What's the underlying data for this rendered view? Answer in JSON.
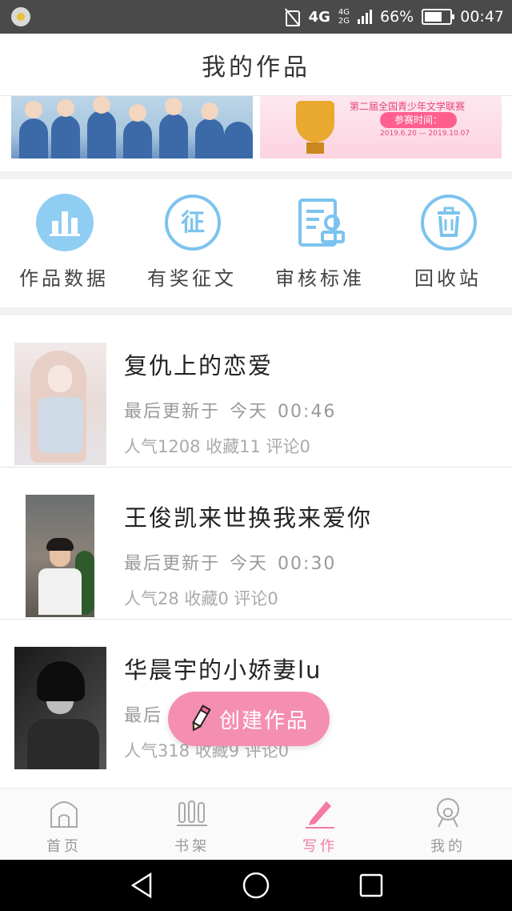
{
  "status_bar": {
    "network": "4G",
    "signal_labels": [
      "4G",
      "2G"
    ],
    "battery": "66%",
    "time": "00:47"
  },
  "header": {
    "title": "我的作品"
  },
  "banners": [
    {
      "name": "cast-photo-banner"
    },
    {
      "title": "第二届全国青少年文学联赛",
      "pill": "参赛时间：",
      "date": "2019.6.20 — 2019.10.07"
    }
  ],
  "menu": [
    {
      "label": "作品数据",
      "icon": "chart-bars-icon"
    },
    {
      "label": "有奖征文",
      "icon": "contest-icon"
    },
    {
      "label": "审核标准",
      "icon": "review-standard-icon"
    },
    {
      "label": "回收站",
      "icon": "trash-icon"
    }
  ],
  "works": [
    {
      "title": "复仇上的恋爱",
      "update_prefix": "最后更新于",
      "update_day": "今天",
      "update_time": "00:46",
      "stats": "人气1208 收藏11 评论0"
    },
    {
      "title": "王俊凯来世换我来爱你",
      "update_prefix": "最后更新于",
      "update_day": "今天",
      "update_time": "00:30",
      "stats": "人气28 收藏0 评论0"
    },
    {
      "title": "华晨宇的小娇妻lu",
      "update_prefix": "最后",
      "update_day": "",
      "update_time": "",
      "stats": "人气318 收藏9 评论0"
    }
  ],
  "create_button": {
    "label": "创建作品",
    "icon": "pencil-icon"
  },
  "tabs": [
    {
      "label": "首页",
      "icon": "home-icon",
      "active": false
    },
    {
      "label": "书架",
      "icon": "bookshelf-icon",
      "active": false
    },
    {
      "label": "写作",
      "icon": "pen-icon",
      "active": true
    },
    {
      "label": "我的",
      "icon": "profile-icon",
      "active": false
    }
  ],
  "colors": {
    "accent": "#f47aa2",
    "icon_blue": "#7cc3ef",
    "create_bg": "#f58fb1"
  }
}
